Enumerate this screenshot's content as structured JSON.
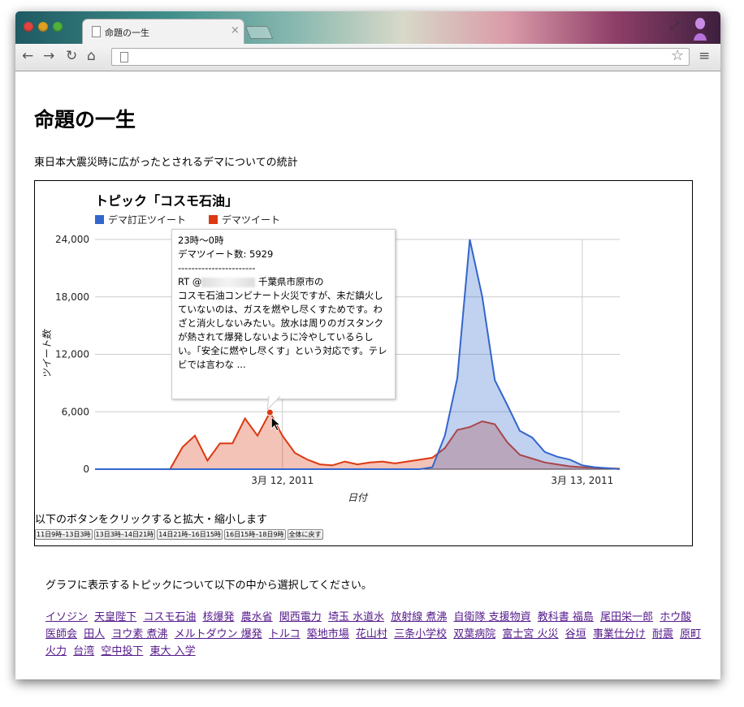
{
  "browser": {
    "tab_title": "命題の一生",
    "tab_close": "×",
    "fullscreen_glyph": "⤢",
    "back_glyph": "←",
    "forward_glyph": "→",
    "reload_glyph": "↻",
    "home_glyph": "⌂",
    "star_glyph": "☆",
    "menu_glyph": "≡",
    "url": ""
  },
  "page": {
    "title": "命題の一生",
    "subtitle": "東日本大震災時に広がったとされるデマについての統計",
    "zoom_instructions": "以下のボタンをクリックすると拡大・縮小します",
    "zoom_buttons": [
      "11日9時–13日3時",
      "13日3時–14日21時",
      "14日21時–16日15時",
      "16日15時–18日9時",
      "全体に戻す"
    ],
    "topic_prompt": "グラフに表示するトピックについて以下の中から選択してください。",
    "topics": [
      "イソジン",
      "天皇陛下",
      "コスモ石油",
      "核爆発",
      "農水省",
      "関西電力",
      "埼玉 水道水",
      "放射線 煮沸",
      "自衛隊 支援物資",
      "教科書 福島",
      "尾田栄一郎",
      "ホウ酸",
      "医師会",
      "田人",
      "ヨウ素 煮沸",
      "メルトダウン 爆発",
      "トルコ",
      "築地市場",
      "花山村",
      "三条小学校",
      "双葉病院",
      "富士宮 火災",
      "谷垣",
      "事業仕分け",
      "耐震",
      "原町 火力",
      "台湾",
      "空中投下",
      "東大 入学"
    ]
  },
  "chart_data": {
    "type": "area",
    "title": "トピック「コスモ石油」",
    "xlabel": "日付",
    "ylabel": "ツイート数",
    "ylim": [
      0,
      24000
    ],
    "yticks": [
      0,
      6000,
      12000,
      18000,
      24000
    ],
    "ytick_labels": [
      "0",
      "6,000",
      "12,000",
      "18,000",
      "24,000"
    ],
    "xlim_hours": [
      0,
      42
    ],
    "xtick_positions_hours": [
      15,
      39
    ],
    "xtick_labels": [
      "3月 12, 2011",
      "3月 13, 2011"
    ],
    "grid": true,
    "legend_position": "top",
    "colors": {
      "correction": "#3366cc",
      "rumor": "#dc3912"
    },
    "series": [
      {
        "name": "デマ訂正ツイート",
        "key": "correction",
        "values": [
          0,
          0,
          0,
          0,
          0,
          0,
          0,
          0,
          0,
          0,
          0,
          0,
          0,
          0,
          0,
          0,
          0,
          0,
          0,
          0,
          0,
          0,
          0,
          0,
          0,
          0,
          0,
          200,
          3500,
          9500,
          24000,
          18000,
          9300,
          6700,
          4000,
          3300,
          1800,
          1300,
          1000,
          400,
          200,
          100,
          0
        ]
      },
      {
        "name": "デマツイート",
        "key": "rumor",
        "values": [
          0,
          0,
          0,
          0,
          0,
          0,
          0,
          2300,
          3500,
          900,
          2700,
          2700,
          5300,
          3500,
          5929,
          3500,
          1700,
          1000,
          500,
          400,
          800,
          500,
          700,
          800,
          600,
          800,
          1000,
          1200,
          2200,
          4100,
          4400,
          5000,
          4700,
          2800,
          1500,
          1100,
          700,
          500,
          300,
          200,
          150,
          100,
          50
        ]
      }
    ],
    "tooltip": {
      "time": "23時〜0時",
      "stat": "デマツイート数: 5929",
      "separator": "-----------------------",
      "rt_prefix": "RT @",
      "rt_after": " 千葉県市原市の",
      "body": "コスモ石油コンビナート火災ですが、未だ鎮火していないのは、ガスを燃やし尽くすためです。わざと消火しないみたい。放水は周りのガスタンクが熱されて爆発しないように冷やしているらしい。「安全に燃やし尽くす」という対応です。テレビでは言わな ...",
      "hour_index": 14
    }
  }
}
